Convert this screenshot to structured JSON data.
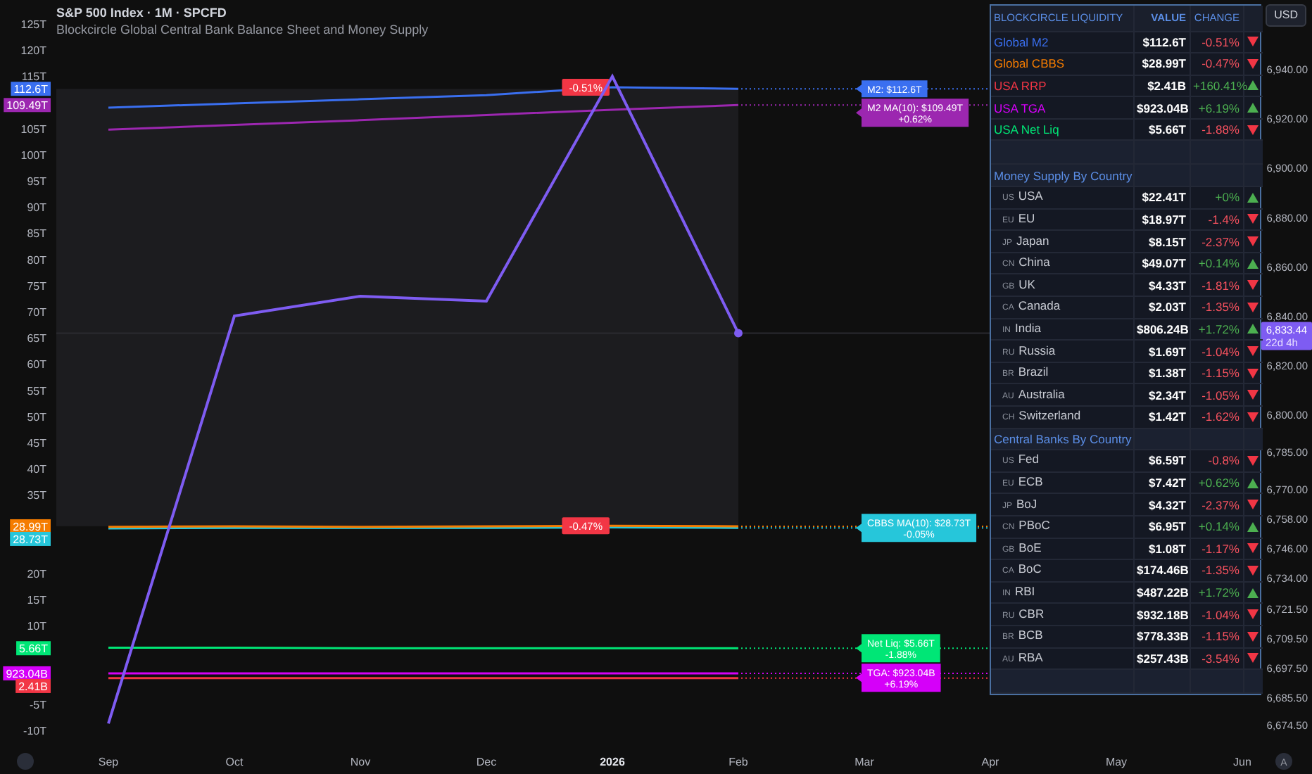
{
  "header": {
    "symbol": "S&P 500 Index · 1M · SPCFD",
    "indicator": "Blockcircle Global Central Bank Balance Sheet and Money Supply"
  },
  "currency_button": "USD",
  "chart": {
    "chart_data": {
      "type": "line",
      "categories": [
        "Sep",
        "Oct",
        "Nov",
        "Dec",
        "2026",
        "Feb",
        "Mar",
        "Apr",
        "May",
        "Jun"
      ],
      "ylim": [
        -10,
        125
      ],
      "yticks": [
        {
          "value": 125,
          "label": "125T"
        },
        {
          "value": 120,
          "label": "120T"
        },
        {
          "value": 115,
          "label": "115T"
        },
        {
          "value": 105,
          "label": "105T"
        },
        {
          "value": 100,
          "label": "100T"
        },
        {
          "value": 95,
          "label": "95T"
        },
        {
          "value": 90,
          "label": "90T"
        },
        {
          "value": 85,
          "label": "85T"
        },
        {
          "value": 80,
          "label": "80T"
        },
        {
          "value": 75,
          "label": "75T"
        },
        {
          "value": 70,
          "label": "70T"
        },
        {
          "value": 65,
          "label": "65T"
        },
        {
          "value": 60,
          "label": "60T"
        },
        {
          "value": 55,
          "label": "55T"
        },
        {
          "value": 50,
          "label": "50T"
        },
        {
          "value": 45,
          "label": "45T"
        },
        {
          "value": 40,
          "label": "40T"
        },
        {
          "value": 35,
          "label": "35T"
        },
        {
          "value": 20,
          "label": "20T"
        },
        {
          "value": 15,
          "label": "15T"
        },
        {
          "value": 10,
          "label": "10T"
        },
        {
          "value": -5,
          "label": "-5T"
        },
        {
          "value": -10,
          "label": "-10T"
        }
      ],
      "series": [
        {
          "color": "#3a6ff0",
          "values": [
            109.0,
            109.8,
            110.6,
            111.4,
            112.9,
            112.6,
            null,
            null,
            null,
            null
          ]
        },
        {
          "color": "#9c27b0",
          "values": [
            104.8,
            105.7,
            106.6,
            107.6,
            108.6,
            109.5,
            null,
            null,
            null,
            null
          ]
        },
        {
          "color": "#f57c00",
          "values": [
            28.9,
            29.0,
            28.9,
            29.0,
            29.1,
            29.0,
            null,
            null,
            null,
            null
          ]
        },
        {
          "color": "#26c6da",
          "values": [
            28.6,
            28.7,
            28.7,
            28.7,
            28.8,
            28.7,
            null,
            null,
            null,
            null
          ]
        },
        {
          "color": "#00e676",
          "values": [
            5.8,
            5.8,
            5.7,
            5.7,
            5.7,
            5.7,
            null,
            null,
            null,
            null
          ]
        },
        {
          "color": "#d500f9",
          "values": [
            0.9,
            0.9,
            0.9,
            0.9,
            0.9,
            0.9,
            null,
            null,
            null,
            null
          ]
        },
        {
          "color": "#f23645",
          "values": [
            0.0,
            0.0,
            0.0,
            0.0,
            0.0,
            0.0,
            null,
            null,
            null,
            null
          ]
        }
      ]
    },
    "series_labels": [
      {
        "axis_tag": "112.6T",
        "callout": [
          "M2: $112.6T"
        ],
        "change_badge": {
          "text": "-0.51%",
          "color": "#f23645"
        }
      },
      {
        "axis_tag": "109.49T",
        "callout": [
          "M2 MA(10): $109.49T",
          "+0.62%"
        ]
      },
      {
        "axis_tag": "28.99T",
        "change_badge": {
          "text": "-0.47%",
          "color": "#f23645"
        }
      },
      {
        "axis_tag": "28.73T",
        "callout": [
          "CBBS MA(10): $28.73T",
          "-0.05%"
        ]
      },
      {
        "axis_tag": "5.66T",
        "callout": [
          "Net Liq: $5.66T",
          "-1.88%"
        ]
      },
      {
        "axis_tag": "923.04B",
        "callout": [
          "TGA: $923.04B",
          "+6.19%"
        ]
      },
      {
        "axis_tag": "2.41B"
      }
    ]
  },
  "price_chart": {
    "chart_data": {
      "type": "line",
      "ylim": [
        6674.5,
        6940
      ],
      "yticks": [
        {
          "value": 6940,
          "label": "6,940.00"
        },
        {
          "value": 6920,
          "label": "6,920.00"
        },
        {
          "value": 6900,
          "label": "6,900.00"
        },
        {
          "value": 6880,
          "label": "6,880.00"
        },
        {
          "value": 6860,
          "label": "6,860.00"
        },
        {
          "value": 6840,
          "label": "6,840.00"
        },
        {
          "value": 6820,
          "label": "6,820.00"
        },
        {
          "value": 6800,
          "label": "6,800.00"
        },
        {
          "value": 6785,
          "label": "6,785.00"
        },
        {
          "value": 6770,
          "label": "6,770.00"
        },
        {
          "value": 6758,
          "label": "6,758.00"
        },
        {
          "value": 6746,
          "label": "6,746.00"
        },
        {
          "value": 6734,
          "label": "6,734.00"
        },
        {
          "value": 6721.5,
          "label": "6,721.50"
        },
        {
          "value": 6709.5,
          "label": "6,709.50"
        },
        {
          "value": 6697.5,
          "label": "6,697.50"
        },
        {
          "value": 6685.5,
          "label": "6,685.50"
        },
        {
          "value": 6674.5,
          "label": "6,674.50"
        }
      ],
      "series": [
        {
          "color": "#7e5cf2",
          "values": [
            6675,
            6840,
            6848,
            6846,
            6937,
            6833,
            null,
            null,
            null,
            null
          ]
        }
      ]
    },
    "last_price": {
      "price": "6,833.44",
      "countdown": "22d 4h"
    }
  },
  "auto_scale_button": "A",
  "liquidity_table": {
    "columns": [
      "BLOCKCIRCLE LIQUIDITY",
      "VALUE",
      "CHANGE"
    ],
    "summary_rows": [
      {
        "name": "Global M2",
        "color": "#3a6ff0",
        "value": "$112.6T",
        "change": "-0.51%",
        "up": false
      },
      {
        "name": "Global CBBS",
        "color": "#f57c00",
        "value": "$28.99T",
        "change": "-0.47%",
        "up": false
      },
      {
        "name": "USA RRP",
        "color": "#f23645",
        "value": "$2.41B",
        "change": "+160.41%",
        "up": true
      },
      {
        "name": "USA TGA",
        "color": "#d500f9",
        "value": "$923.04B",
        "change": "+6.19%",
        "up": true
      },
      {
        "name": "USA Net Liq",
        "color": "#00e676",
        "value": "$5.66T",
        "change": "-1.88%",
        "up": false
      }
    ],
    "sections": [
      {
        "title": "Money Supply By Country",
        "rows": [
          {
            "code": "US",
            "name": "USA",
            "value": "$22.41T",
            "change": "+0%",
            "up": true
          },
          {
            "code": "EU",
            "name": "EU",
            "value": "$18.97T",
            "change": "-1.4%",
            "up": false
          },
          {
            "code": "JP",
            "name": "Japan",
            "value": "$8.15T",
            "change": "-2.37%",
            "up": false
          },
          {
            "code": "CN",
            "name": "China",
            "value": "$49.07T",
            "change": "+0.14%",
            "up": true
          },
          {
            "code": "GB",
            "name": "UK",
            "value": "$4.33T",
            "change": "-1.81%",
            "up": false
          },
          {
            "code": "CA",
            "name": "Canada",
            "value": "$2.03T",
            "change": "-1.35%",
            "up": false
          },
          {
            "code": "IN",
            "name": "India",
            "value": "$806.24B",
            "change": "+1.72%",
            "up": true
          },
          {
            "code": "RU",
            "name": "Russia",
            "value": "$1.69T",
            "change": "-1.04%",
            "up": false
          },
          {
            "code": "BR",
            "name": "Brazil",
            "value": "$1.38T",
            "change": "-1.15%",
            "up": false
          },
          {
            "code": "AU",
            "name": "Australia",
            "value": "$2.34T",
            "change": "-1.05%",
            "up": false
          },
          {
            "code": "CH",
            "name": "Switzerland",
            "value": "$1.42T",
            "change": "-1.62%",
            "up": false
          }
        ]
      },
      {
        "title": "Central Banks By Country",
        "rows": [
          {
            "code": "US",
            "name": "Fed",
            "value": "$6.59T",
            "change": "-0.8%",
            "up": false
          },
          {
            "code": "EU",
            "name": "ECB",
            "value": "$7.42T",
            "change": "+0.62%",
            "up": true
          },
          {
            "code": "JP",
            "name": "BoJ",
            "value": "$4.32T",
            "change": "-2.37%",
            "up": false
          },
          {
            "code": "CN",
            "name": "PBoC",
            "value": "$6.95T",
            "change": "+0.14%",
            "up": true
          },
          {
            "code": "GB",
            "name": "BoE",
            "value": "$1.08T",
            "change": "-1.17%",
            "up": false
          },
          {
            "code": "CA",
            "name": "BoC",
            "value": "$174.46B",
            "change": "-1.35%",
            "up": false
          },
          {
            "code": "IN",
            "name": "RBI",
            "value": "$487.22B",
            "change": "+1.72%",
            "up": true
          },
          {
            "code": "RU",
            "name": "CBR",
            "value": "$932.18B",
            "change": "-1.04%",
            "up": false
          },
          {
            "code": "BR",
            "name": "BCB",
            "value": "$778.33B",
            "change": "-1.15%",
            "up": false
          },
          {
            "code": "AU",
            "name": "RBA",
            "value": "$257.43B",
            "change": "-3.54%",
            "up": false
          }
        ]
      }
    ]
  }
}
